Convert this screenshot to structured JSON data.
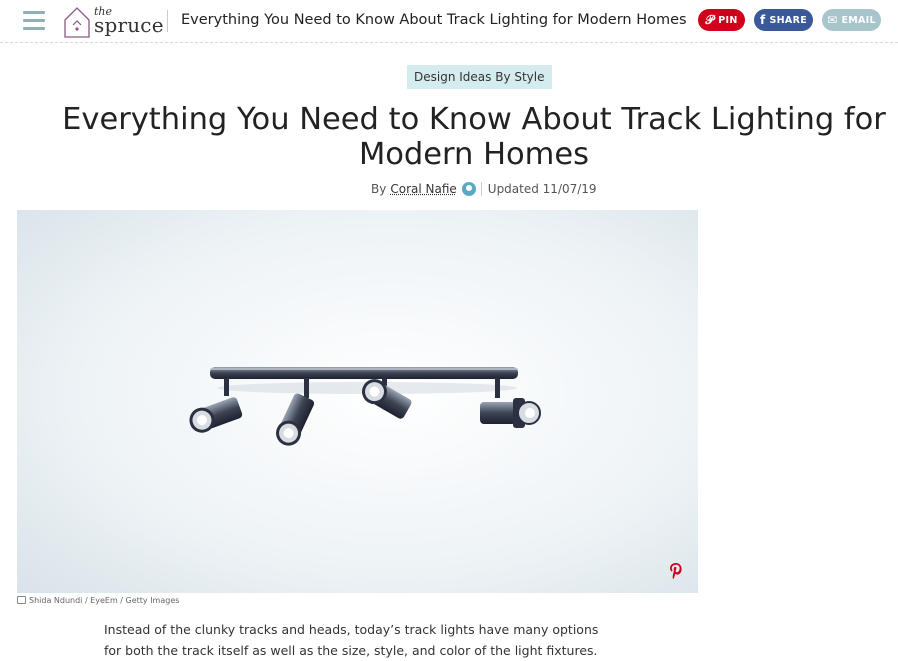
{
  "header": {
    "logo_the": "the",
    "logo_spruce": "spruce",
    "title": "Everything You Need to Know About Track Lighting for Modern Homes",
    "share": {
      "pin_label": "PIN",
      "share_label": "SHARE",
      "email_label": "EMAIL",
      "pin_color": "#d0021b",
      "facebook_color": "#3b5998",
      "email_color": "#a8c5cc"
    }
  },
  "article": {
    "category": "Design Ideas By Style",
    "headline": "Everything You Need to Know About Track Lighting for Modern Homes",
    "byline_prefix": "By",
    "author": "Coral Nafie",
    "updated": "Updated 11/07/19",
    "image_credit": "Shida Ndundi / EyeEm / Getty Images",
    "intro": "Instead of the clunky tracks and heads, today’s track lights have many options for both the track itself as well as the size, style, and color of the light fixtures."
  },
  "icons": {
    "menu": "hamburger-menu-icon",
    "logo": "house-logo-icon",
    "pin": "pinterest-icon",
    "facebook": "facebook-icon",
    "email": "email-envelope-icon",
    "expert": "expert-badge-icon",
    "camera": "camera-icon"
  }
}
